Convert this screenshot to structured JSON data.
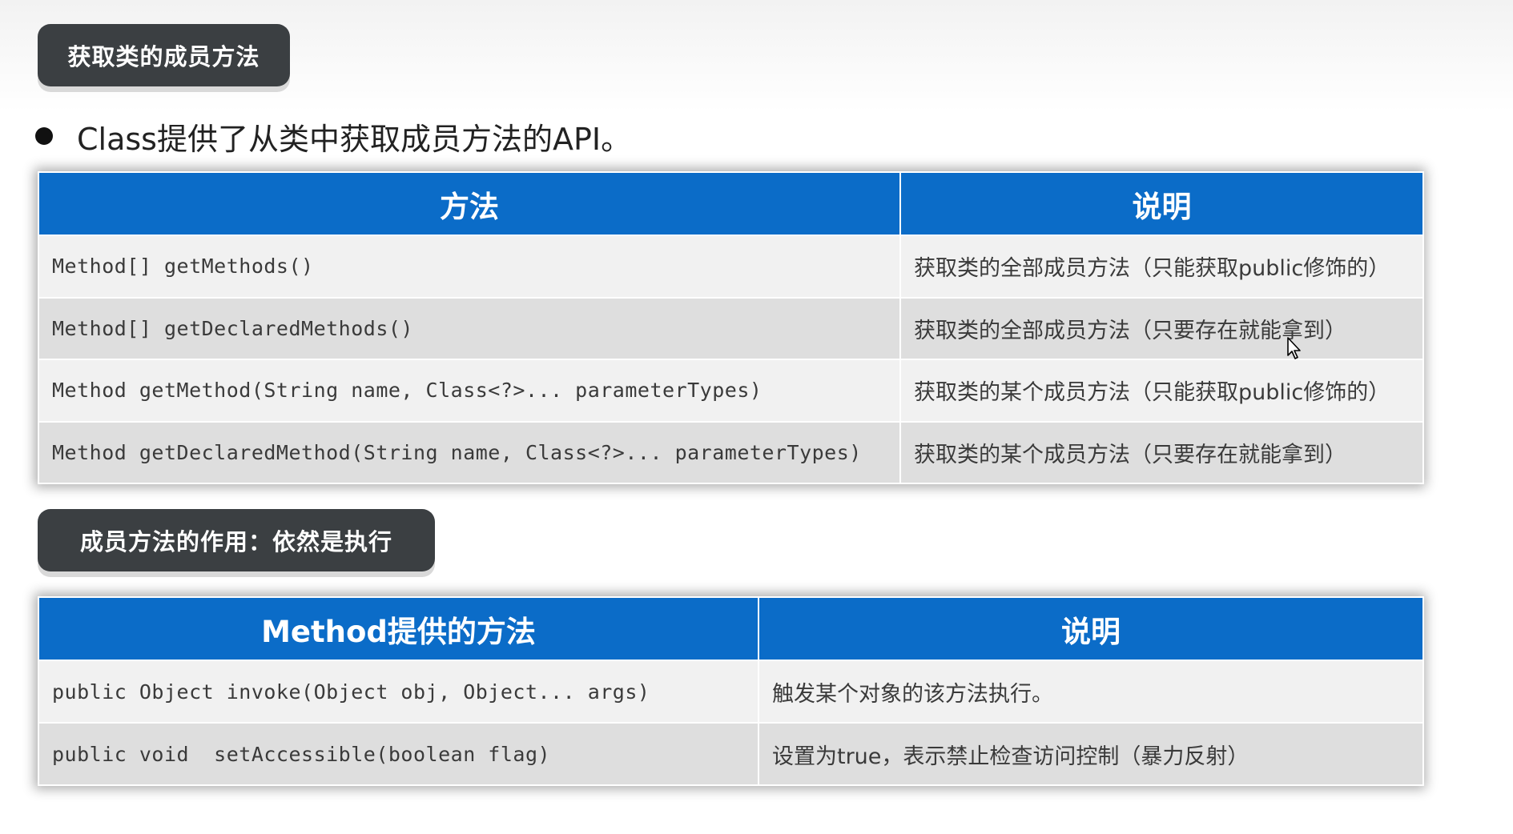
{
  "section1": {
    "tag": "获取类的成员方法",
    "bullet": "Class提供了从类中获取成员方法的API。",
    "table": {
      "headers": [
        "方法",
        "说明"
      ],
      "rows": [
        [
          "Method[] getMethods()",
          "获取类的全部成员方法（只能获取public修饰的）"
        ],
        [
          "Method[] getDeclaredMethods()",
          "获取类的全部成员方法（只要存在就能拿到）"
        ],
        [
          "Method getMethod(String name, Class<?>... parameterTypes)",
          "获取类的某个成员方法（只能获取public修饰的）"
        ],
        [
          "Method getDeclaredMethod(String name, Class<?>... parameterTypes)",
          "获取类的某个成员方法（只要存在就能拿到）"
        ]
      ]
    }
  },
  "section2": {
    "tag": "成员方法的作用：依然是执行",
    "table": {
      "headers": [
        "Method提供的方法",
        "说明"
      ],
      "rows": [
        [
          "public Object invoke(Object obj, Object... args)",
          "触发某个对象的该方法执行。"
        ],
        [
          "public void  setAccessible(boolean flag)",
          "设置为true，表示禁止检查访问控制（暴力反射）"
        ]
      ]
    }
  },
  "colors": {
    "header_blue": "#0b6cc8",
    "tag_dark": "#3b3f42"
  },
  "icons": {
    "cursor": "mouse-pointer-icon",
    "bullet": "bullet-dot-icon"
  }
}
